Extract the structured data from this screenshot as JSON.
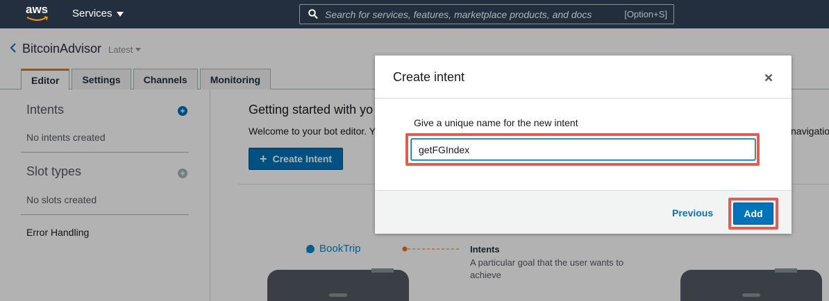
{
  "topnav": {
    "logo_text": "aws",
    "services_label": "Services",
    "search_placeholder": "Search for services, features, marketplace products, and docs",
    "search_shortcut": "[Option+S]"
  },
  "bot": {
    "name": "BitcoinAdvisor",
    "version": "Latest"
  },
  "tabs": [
    {
      "label": "Editor",
      "active": true
    },
    {
      "label": "Settings",
      "active": false
    },
    {
      "label": "Channels",
      "active": false
    },
    {
      "label": "Monitoring",
      "active": false
    }
  ],
  "sidebar": {
    "intents_heading": "Intents",
    "intents_empty": "No intents created",
    "slots_heading": "Slot types",
    "slots_empty": "No slots created",
    "error_handling": "Error Handling"
  },
  "main": {
    "title": "Getting started with yo",
    "welcome_text": "Welcome to your bot editor. Y",
    "welcome_text_right": "navigatio",
    "create_intent_label": "Create Intent",
    "diagram": {
      "booktrip_label": "BookTrip",
      "intents_title": "Intents",
      "intents_desc": "A particular goal that the user wants to achieve"
    }
  },
  "modal": {
    "title": "Create intent",
    "field_label": "Give a unique name for the new intent",
    "field_value": "getFGIndex",
    "previous_label": "Previous",
    "add_label": "Add"
  },
  "colors": {
    "nav_bg": "#232f3e",
    "primary": "#0073bb",
    "highlight": "#e25c52",
    "tab_accent": "#ec7211"
  }
}
